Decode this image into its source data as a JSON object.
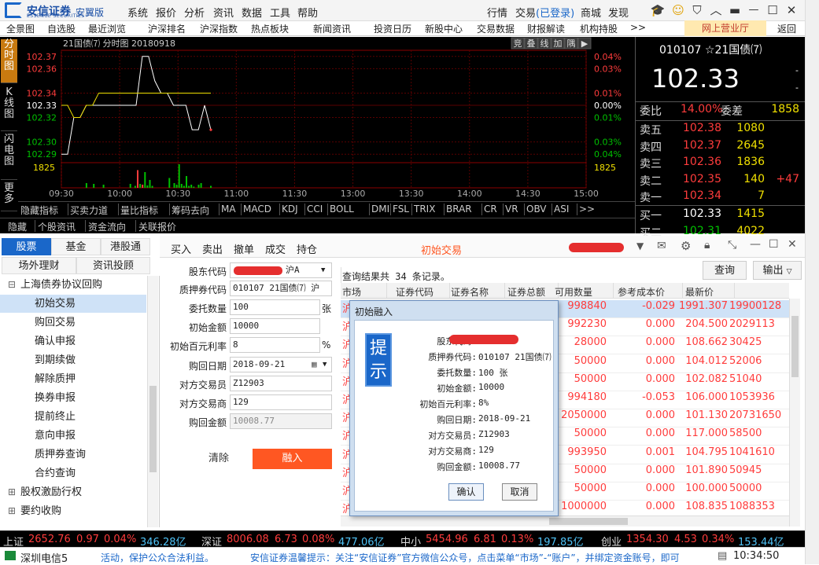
{
  "brand": {
    "name": "安信证券",
    "sub": "ESSENCE SECURITIES",
    "ver": "安翼版"
  },
  "top_menu": [
    "系统",
    "报价",
    "分析",
    "资讯",
    "数据",
    "工具",
    "帮助"
  ],
  "top_right": {
    "quote": "行情",
    "trade": "交易",
    "trade_status": "(已登录)",
    "mall": "商城",
    "discover": "发现"
  },
  "nav": [
    "全景图",
    "自选股",
    "最近浏览",
    "沪深排名",
    "沪深指数",
    "热点板块",
    "新闻资讯",
    "投资日历",
    "新股中心",
    "交易数据",
    "财报解读",
    "机构持股",
    ">>"
  ],
  "nav_online": "网上营业厅",
  "nav_back": "返回",
  "vtabs": [
    "分时图",
    "K线图",
    "闪电图",
    "更多"
  ],
  "chart_title": "21国债⑺ 分时图 20180918",
  "chart_tools": [
    "竞",
    "叠",
    "线",
    "加",
    "隅",
    "▶"
  ],
  "chart_data": {
    "type": "line",
    "title": "21国债⑺ 分时图 20180918",
    "x_ticks": [
      "09:30",
      "10:00",
      "10:30",
      "11:00",
      "11:30",
      "13:00",
      "13:30",
      "14:00",
      "14:30",
      "15:00"
    ],
    "y_left": [
      "102.37",
      "102.36",
      "102.34",
      "102.33",
      "102.32",
      "102.30",
      "102.29"
    ],
    "y_right": [
      "0.04%",
      "0.03%",
      "0.01%",
      "0.00%",
      "0.01%",
      "0.03%",
      "0.04%"
    ],
    "vol_left": "1825",
    "vol_right": "1825",
    "price": [
      102.29,
      102.29,
      102.32,
      102.32,
      102.33,
      102.33,
      102.33,
      102.33,
      102.33,
      102.33,
      102.33,
      102.33,
      102.33,
      102.37,
      102.37,
      102.35,
      102.34,
      102.34,
      102.33,
      102.33,
      102.33,
      102.31,
      102.31,
      102.33,
      102.31
    ],
    "avg": [
      102.33,
      102.33,
      102.32,
      102.32,
      102.33,
      102.33,
      102.34,
      102.34,
      102.34,
      102.34,
      102.34,
      102.34,
      102.34,
      102.34,
      102.34,
      102.34,
      102.34,
      102.34,
      102.34,
      102.34,
      102.34,
      102.34,
      102.34,
      102.34,
      102.34
    ],
    "volumes": [
      0,
      0,
      0,
      0,
      0,
      0,
      0,
      0,
      0,
      12,
      0,
      0,
      10,
      0,
      0,
      0,
      8,
      0,
      0,
      0,
      0,
      0,
      0,
      0,
      0,
      0,
      0,
      10,
      0,
      5,
      45,
      10,
      8,
      40,
      6,
      20,
      5,
      0,
      0,
      0,
      0,
      0,
      0,
      25,
      0,
      12,
      8,
      60,
      10,
      5,
      30,
      5,
      8,
      3,
      0,
      8,
      12,
      0,
      0,
      0,
      5,
      0
    ],
    "volume_colors": [
      "g",
      "g",
      "g",
      "g",
      "g",
      "g",
      "g",
      "g",
      "g",
      "g",
      "g",
      "g",
      "g",
      "g",
      "g",
      "g",
      "g",
      "g",
      "g",
      "g",
      "g",
      "g",
      "g",
      "g",
      "g",
      "g",
      "g",
      "g",
      "g",
      "g",
      "r",
      "g",
      "r",
      "g",
      "g",
      "g",
      "g",
      "g",
      "g",
      "g",
      "g",
      "g",
      "g",
      "g",
      "g",
      "g",
      "g",
      "g",
      "g",
      "g",
      "g",
      "g",
      "g",
      "g",
      "g",
      "g",
      "g",
      "g",
      "g",
      "g",
      "g",
      "g"
    ]
  },
  "indicators": [
    "隐藏指标",
    "买卖力道",
    "量比指标",
    "筹码去向",
    "MA",
    "MACD",
    "KDJ",
    "CCI",
    "BOLL",
    "DMI",
    "FSL",
    "TRIX",
    "BRAR",
    "CR",
    "VR",
    "OBV",
    "ASI",
    ">>"
  ],
  "hide_tabs": [
    "隐藏",
    "个股资讯",
    "资金流向",
    "关联报价"
  ],
  "stock": {
    "code": "010107",
    "star": "☆",
    "name": "21国债⑺",
    "price": "102.33",
    "dash1": "-",
    "dash2": "-"
  },
  "weibi": {
    "label": "委比",
    "value": "14.00%",
    "label2": "委差",
    "value2": "1858"
  },
  "asks": [
    {
      "label": "卖五",
      "price": "102.38",
      "vol": "1080",
      "delta": ""
    },
    {
      "label": "卖四",
      "price": "102.37",
      "vol": "2645",
      "delta": ""
    },
    {
      "label": "卖三",
      "price": "102.36",
      "vol": "1836",
      "delta": ""
    },
    {
      "label": "卖二",
      "price": "102.35",
      "vol": "140",
      "delta": "+47"
    },
    {
      "label": "卖一",
      "price": "102.34",
      "vol": "7",
      "delta": ""
    }
  ],
  "bids": [
    {
      "label": "买一",
      "price": "102.33",
      "vol": "1415"
    },
    {
      "label": "买二",
      "price": "102.31",
      "vol": "4022"
    }
  ],
  "left_tabs": [
    "股票",
    "基金",
    "港股通",
    "场外理财",
    "资讯投顾"
  ],
  "tree": [
    {
      "label": "上海债券协议回购",
      "indent": 0,
      "prefix": "⊟"
    },
    {
      "label": "初始交易",
      "indent": 1,
      "prefix": ""
    },
    {
      "label": "购回交易",
      "indent": 1,
      "prefix": ""
    },
    {
      "label": "确认申报",
      "indent": 1,
      "prefix": ""
    },
    {
      "label": "到期续做",
      "indent": 1,
      "prefix": ""
    },
    {
      "label": "解除质押",
      "indent": 1,
      "prefix": ""
    },
    {
      "label": "换券申报",
      "indent": 1,
      "prefix": ""
    },
    {
      "label": "提前终止",
      "indent": 1,
      "prefix": ""
    },
    {
      "label": "意向申报",
      "indent": 1,
      "prefix": ""
    },
    {
      "label": "质押券查询",
      "indent": 1,
      "prefix": ""
    },
    {
      "label": "合约查询",
      "indent": 1,
      "prefix": ""
    },
    {
      "label": "股权激励行权",
      "indent": 0,
      "prefix": "⊞"
    },
    {
      "label": "要约收购",
      "indent": 0,
      "prefix": "⊞"
    }
  ],
  "op_tabs": [
    "买入",
    "卖出",
    "撤单",
    "成交",
    "持仓"
  ],
  "op_title": "初始交易",
  "form": {
    "stock_code_label": "股东代码",
    "stock_code_suffix": "沪A",
    "bond_code_label": "质押券代码",
    "bond_code_value": "010107 21国债⑺ 沪",
    "qty_label": "委托数量",
    "qty_value": "100",
    "qty_unit": "张",
    "amount_label": "初始金额",
    "amount_value": "10000",
    "rate_label": "初始百元利率",
    "rate_value": "8",
    "rate_unit": "%",
    "date_label": "购回日期",
    "date_value": "2018-09-21",
    "trader_label": "对方交易员",
    "trader_value": "Z12903",
    "dealer_label": "对方交易商",
    "dealer_value": "129",
    "back_label": "购回金额",
    "back_value": "10008.77",
    "clear_btn": "清除",
    "submit_btn": "融入"
  },
  "query": {
    "result": "查询结果共 34 条记录。",
    "query_btn": "查询",
    "export_btn": "输出"
  },
  "table_headers": [
    "市场",
    "证券代码",
    "证券名称",
    "证券总额",
    "可用数量",
    "参考成本价",
    "最新价"
  ],
  "table_rows": [
    {
      "avail": "998840",
      "cost": "-0.029",
      "last": "1991.307",
      "extra": "19900128"
    },
    {
      "avail": "992230",
      "cost": "0.000",
      "last": "204.500",
      "extra": "2029113"
    },
    {
      "avail": "28000",
      "cost": "0.000",
      "last": "108.662",
      "extra": "30425"
    },
    {
      "avail": "50000",
      "cost": "0.000",
      "last": "104.012",
      "extra": "52006"
    },
    {
      "avail": "50000",
      "cost": "0.000",
      "last": "102.082",
      "extra": "51040"
    },
    {
      "avail": "994180",
      "cost": "-0.053",
      "last": "106.000",
      "extra": "1053936"
    },
    {
      "avail": "2050000",
      "cost": "0.000",
      "last": "101.130",
      "extra": "20731650"
    },
    {
      "avail": "50000",
      "cost": "0.000",
      "last": "117.000",
      "extra": "58500"
    },
    {
      "avail": "993950",
      "cost": "0.001",
      "last": "104.795",
      "extra": "1041610"
    },
    {
      "avail": "50000",
      "cost": "0.000",
      "last": "101.890",
      "extra": "50945"
    },
    {
      "avail": "50000",
      "cost": "0.000",
      "last": "100.000",
      "extra": "50000"
    },
    {
      "avail": "1000000",
      "cost": "0.000",
      "last": "108.835",
      "extra": "1088353"
    }
  ],
  "market_char": "沪",
  "dialog": {
    "title": "初始融入",
    "badge": "提示",
    "rows": [
      {
        "label": "股东代码:",
        "value": ""
      },
      {
        "label": "质押券代码:",
        "value": "010107  21国债⑺"
      },
      {
        "label": "委托数量:",
        "value": "100 张"
      },
      {
        "label": "初始金额:",
        "value": "10000"
      },
      {
        "label": "初始百元利率:",
        "value": "8%"
      },
      {
        "label": "购回日期:",
        "value": "2018-09-21"
      },
      {
        "label": "对方交易员:",
        "value": "Z12903"
      },
      {
        "label": "对方交易商:",
        "value": "129"
      },
      {
        "label": "购回金额:",
        "value": "10008.77"
      }
    ],
    "ok": "确认",
    "cancel": "取消"
  },
  "status": [
    {
      "name": "上证",
      "price": "2652.76",
      "chg": "0.97",
      "pct": "0.04%",
      "amt": "346.28亿"
    },
    {
      "name": "深证",
      "price": "8006.08",
      "chg": "6.73",
      "pct": "0.08%",
      "amt": "477.06亿"
    },
    {
      "name": "中小",
      "price": "5454.96",
      "chg": "6.81",
      "pct": "0.13%",
      "amt": "197.85亿"
    },
    {
      "name": "创业",
      "price": "1354.30",
      "chg": "4.53",
      "pct": "0.34%",
      "amt": "153.44亿"
    }
  ],
  "bottom": {
    "server": "深圳电信5",
    "notice1": "活动，保护公众合法利益。",
    "notice2": "安信证券温馨提示：关注“安信证券”官方微信公众号，点击菜单“市场”-“账户”，并绑定资金账号，即可",
    "time": "10:34:50"
  },
  "colors": {
    "red": "#ff3c3c",
    "green": "#00c000",
    "yellow": "#f0e000",
    "accent": "#ff5722",
    "blue": "#1a67c9"
  }
}
